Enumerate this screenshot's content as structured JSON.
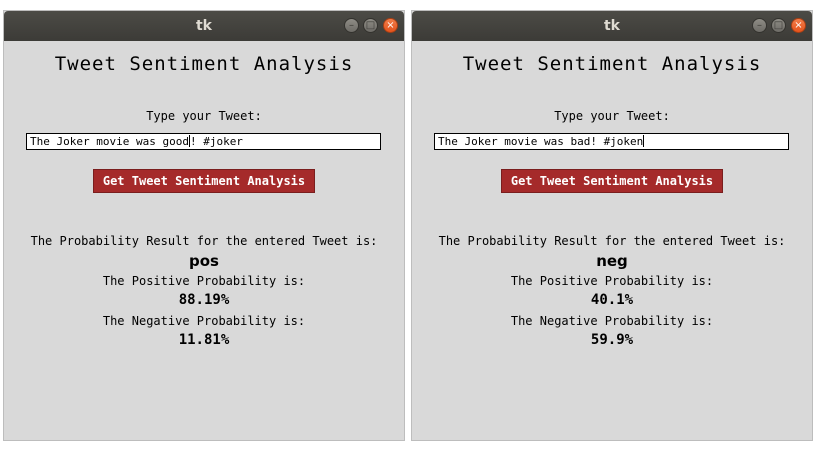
{
  "windows": [
    {
      "title": "tk",
      "app_title": "Tweet Sentiment Analysis",
      "prompt": "Type your Tweet:",
      "tweet_before_caret": "The Joker movie was good",
      "tweet_after_caret": "! #joker",
      "button_label": "Get Tweet Sentiment Analysis",
      "result_header": "The Probability Result for the entered Tweet is:",
      "result_label": "pos",
      "positive_label": "The Positive Probability is:",
      "positive_value": "88.19%",
      "negative_label": "The Negative Probability is:",
      "negative_value": "11.81%"
    },
    {
      "title": "tk",
      "app_title": "Tweet Sentiment Analysis",
      "prompt": "Type your Tweet:",
      "tweet_before_caret": "The Joker movie was bad! #joken",
      "tweet_after_caret": "",
      "button_label": "Get Tweet Sentiment Analysis",
      "result_header": "The Probability Result for the entered Tweet is:",
      "result_label": "neg",
      "positive_label": "The Positive Probability is:",
      "positive_value": "40.1%",
      "negative_label": "The Negative Probability is:",
      "negative_value": "59.9%"
    }
  ],
  "window_controls": {
    "minimize_icon": "minimize-icon",
    "maximize_icon": "maximize-icon",
    "close_icon": "close-icon"
  },
  "colors": {
    "button_bg": "#a52a2a",
    "window_bg": "#d9d9d9",
    "titlebar_bg": "#3c3b37",
    "close_button": "#e5531c"
  }
}
